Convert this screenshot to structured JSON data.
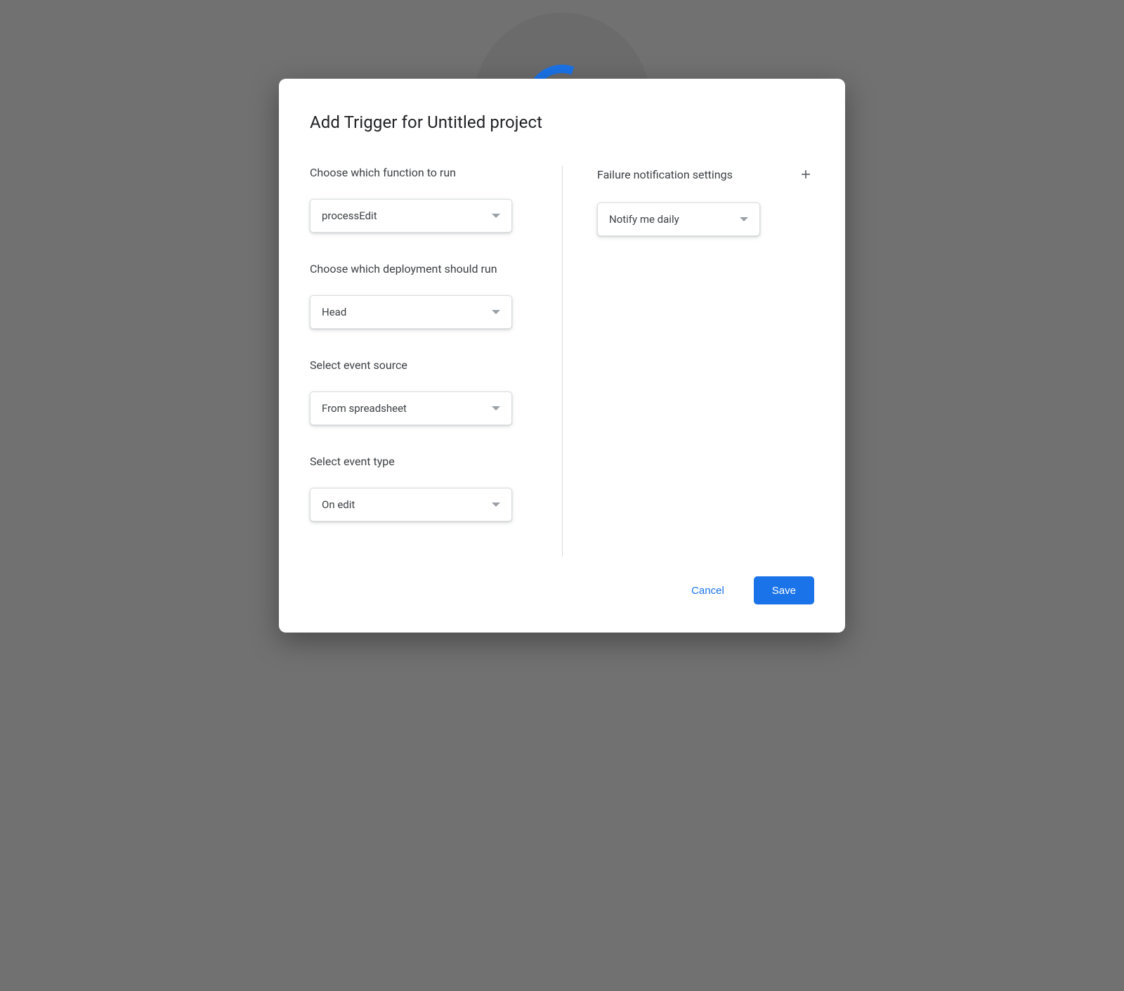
{
  "dialog": {
    "title": "Add Trigger for Untitled project",
    "left": {
      "function": {
        "label": "Choose which function to run",
        "value": "processEdit"
      },
      "deployment": {
        "label": "Choose which deployment should run",
        "value": "Head"
      },
      "event_source": {
        "label": "Select event source",
        "value": "From spreadsheet"
      },
      "event_type": {
        "label": "Select event type",
        "value": "On edit"
      }
    },
    "right": {
      "notification": {
        "label": "Failure notification settings",
        "value": "Notify me daily"
      }
    },
    "actions": {
      "cancel": "Cancel",
      "save": "Save"
    }
  }
}
